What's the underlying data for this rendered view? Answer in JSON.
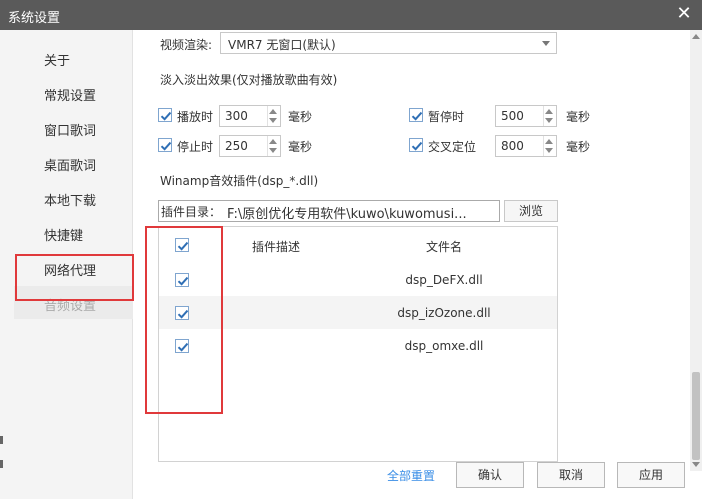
{
  "window": {
    "title": "系统设置"
  },
  "sidebar": {
    "items": [
      {
        "label": "关于"
      },
      {
        "label": "常规设置"
      },
      {
        "label": "窗口歌词"
      },
      {
        "label": "桌面歌词"
      },
      {
        "label": "本地下载"
      },
      {
        "label": "快捷键"
      },
      {
        "label": "网络代理"
      },
      {
        "label": "音频设置"
      }
    ]
  },
  "video": {
    "label": "视频渲染:",
    "value": "VMR7 无窗口(默认)"
  },
  "fade": {
    "heading": "淡入淡出效果(仅对播放歌曲有效)",
    "play": {
      "label": "播放时",
      "value": "300",
      "unit": "毫秒",
      "checked": true
    },
    "pause": {
      "label": "暂停时",
      "value": "500",
      "unit": "毫秒",
      "checked": true
    },
    "stop": {
      "label": "停止时",
      "value": "250",
      "unit": "毫秒",
      "checked": true
    },
    "seek": {
      "label": "交叉定位",
      "value": "800",
      "unit": "毫秒",
      "checked": true
    }
  },
  "winamp": {
    "heading": "Winamp音效插件(dsp_*.dll)",
    "dir_label": "插件目录：",
    "dir_value": "F:\\原创优化专用软件\\kuwo\\kuwomusi...",
    "browse_label": "浏览",
    "columns": {
      "desc": "插件描述",
      "file": "文件名"
    },
    "plugins": [
      {
        "file": "dsp_DeFX.dll",
        "checked": true
      },
      {
        "file": "dsp_izOzone.dll",
        "checked": true
      },
      {
        "file": "dsp_omxe.dll",
        "checked": true
      }
    ]
  },
  "footer": {
    "reset_label": "全部重置",
    "ok_label": "确认",
    "cancel_label": "取消",
    "apply_label": "应用"
  },
  "colors": {
    "accent": "#3a8ee6",
    "highlight_box": "#e0393b",
    "titlebar": "#5a5a5a"
  }
}
